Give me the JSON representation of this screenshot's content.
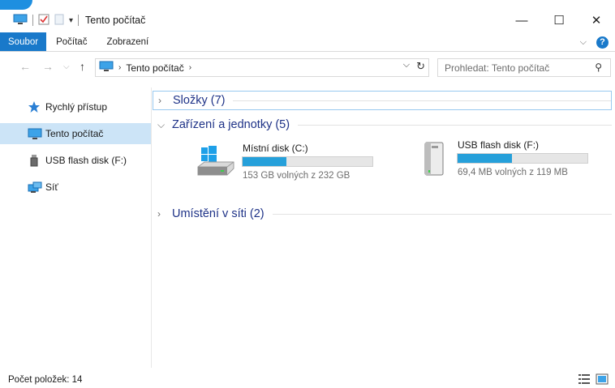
{
  "window": {
    "title": "Tento počítač",
    "caption": {
      "minimize": "—",
      "maximize": "☐",
      "close": "✕"
    }
  },
  "ribbon": {
    "tabs": [
      {
        "label": "Soubor"
      },
      {
        "label": "Počítač"
      },
      {
        "label": "Zobrazení"
      }
    ],
    "collapse": "⌵",
    "help": "?"
  },
  "address": {
    "back": "←",
    "forward": "→",
    "recent": "⌵",
    "up": "↑",
    "crumb_sep": "›",
    "crumb": "Tento počítač",
    "crumb_chevron": "›",
    "dropdown": "⌵",
    "refresh": "↻"
  },
  "search": {
    "placeholder": "Prohledat: Tento počítač",
    "icon": "⚲"
  },
  "nav": {
    "items": [
      {
        "label": "Rychlý přístup"
      },
      {
        "label": "Tento počítač"
      },
      {
        "label": "USB flash disk (F:)"
      },
      {
        "label": "Síť"
      }
    ]
  },
  "groups": {
    "folders": {
      "title": "Složky (7)",
      "chevron": "›"
    },
    "devices": {
      "title": "Zařízení a jednotky (5)",
      "chevron": "⌵"
    },
    "network": {
      "title": "Umístění v síti (2)",
      "chevron": "›"
    }
  },
  "drives": [
    {
      "name": "Místní disk (C:)",
      "free_text": "153 GB volných z 232 GB",
      "used_fraction": 0.34
    },
    {
      "name": "USB flash disk (F:)",
      "free_text": "69,4 MB volných z 119 MB",
      "used_fraction": 0.42
    }
  ],
  "status": {
    "count": "Počet položek: 14"
  },
  "colors": {
    "accent": "#1979ca",
    "selection": "#cce4f7",
    "usage_bar": "#26a0da",
    "group_title": "#1e3287"
  }
}
